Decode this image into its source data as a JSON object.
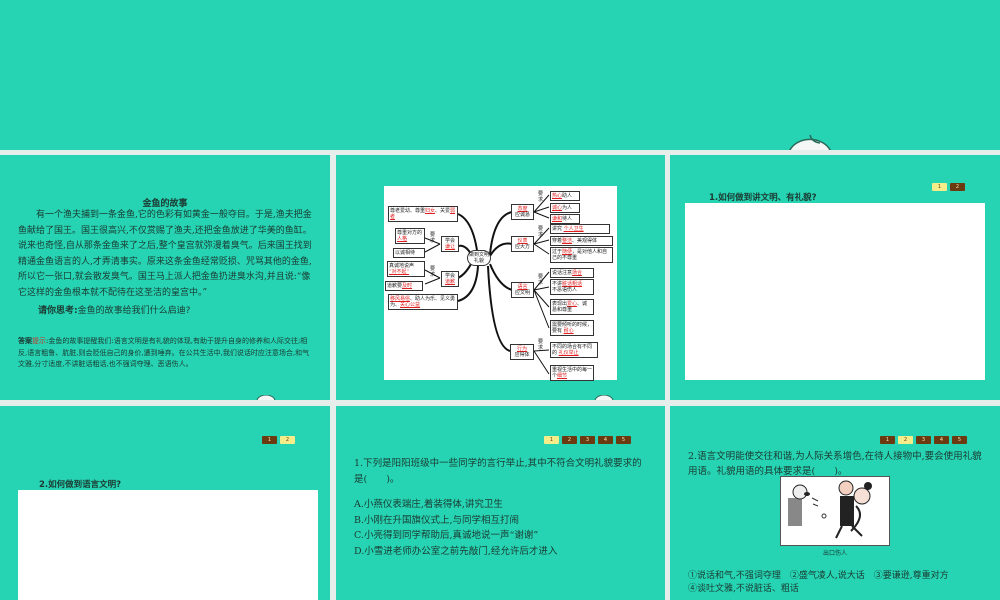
{
  "slides": {
    "story": {
      "title": "金鱼的故事",
      "body": "有一个渔夫捕到一条金鱼,它的色彩有如黄金一般夺目。于是,渔夫把金鱼献给了国王。国王很高兴,不仅赏赐了渔夫,还把金鱼放进了华美的鱼缸。说来也奇怪,自从那条金鱼来了之后,整个皇宫就弥漫着臭气。后来国王找到精通金鱼语言的人,才弄清事实。原来这条金鱼经常贬损、咒骂其他的金鱼,所以它一张口,就会散发臭气。国王马上派人把金鱼扔进臭水沟,并且说:“像它这样的金鱼根本就不配待在这圣洁的皇宫中。”",
      "think_label": "请你思考:",
      "think": "金鱼的故事给我们什么启迪?",
      "answer_label": "答案",
      "hint_label": "提示",
      "answer": ":金鱼的故事提醒我们:语言文明是有礼貌的体现,有助于提升自身的修养和人际交往;相反,语言粗鲁、肮脏,则会贬低自己的身价,遭到唾弃。在公共生活中,我们说话时应注意场合,和气文雅,分寸适度,不讲脏话粗话,也不强词夺理、恶语伤人。"
    },
    "mindmap": {
      "center": "做到文明礼貌",
      "require": "要求",
      "left": {
        "respect": [
          "尊老爱幼、尊重",
          "妇女",
          "、关爱",
          "弱者"
        ],
        "humble_node": [
          "学会",
          "谦让"
        ],
        "humble": [
          [
            "尊重对方的",
            "人格"
          ],
          [
            "以诚相待"
          ]
        ],
        "apology_node": [
          "学会",
          "道歉"
        ],
        "apology": [
          [
            "真诚地说声",
            "“对不起”"
          ],
          [
            "道歉要",
            "及时"
          ]
        ],
        "public": [
          "移风易俗",
          "、助人为乐、见义勇为、",
          "关心公益"
        ]
      },
      "right": [
        {
          "node": [
            "态度",
            "应诚恳"
          ],
          "items": [
            [
              "热心",
              "助人"
            ],
            [
              "诚心",
              "为人"
            ],
            [
              "谦和",
              "待人"
            ]
          ]
        },
        {
          "node": [
            "仪表",
            "应大方"
          ],
          "items": [
            [
              "讲究 ",
              "个人卫生",
              ""
            ],
            [
              "穿着",
              "整洁",
              "、美观得体"
            ],
            [
              "过于",
              "随便",
              "，是对他人和自己的不尊重"
            ]
          ]
        },
        {
          "node": [
            "语言",
            "应文明"
          ],
          "items": [
            [
              "说话注意",
              "场合",
              ""
            ],
            [
              "不讲",
              "脏话粗话",
              "不恶语伤人"
            ],
            [
              "表现出",
              "爱心",
              "、诚恳和尊重"
            ],
            [
              "需要倾听的时候，要有 ",
              "耐心",
              ""
            ]
          ]
        },
        {
          "node": [
            "行为",
            "应得体"
          ],
          "items": [
            [
              "不同的场合有不同的 ",
              "礼仪举止",
              ""
            ],
            [
              "重视生活中的每一个",
              "细节",
              ""
            ]
          ]
        }
      ]
    },
    "q_polite": {
      "title": "1.如何做到讲文明、有礼貌?",
      "pages": [
        "1",
        "2"
      ],
      "active": 0
    },
    "q_language": {
      "title": "2.如何做到语言文明?",
      "pages": [
        "1",
        "2"
      ],
      "active": 1
    },
    "ex1": {
      "pages": [
        "1",
        "2",
        "3",
        "4",
        "5"
      ],
      "active": 0,
      "question": "1.下列是阳阳班级中一些同学的言行举止,其中不符合文明礼貌要求的是(　　)。",
      "options": [
        "A.小燕仪表端庄,着装得体,讲究卫生",
        "B.小刚在升国旗仪式上,与同学相互打闹",
        "C.小亮得到同学帮助后,真诚地说一声“谢谢”",
        "D.小雪进老师办公室之前先敲门,经允许后才进入"
      ]
    },
    "ex2": {
      "pages": [
        "1",
        "2",
        "3",
        "4",
        "5"
      ],
      "active": 1,
      "question": "2.语言文明能使交往和谐,为人际关系增色,在待人接物中,要会使用礼貌用语。礼貌用语的具体要求是(　　)。",
      "caption": "出口伤人",
      "statements": [
        "①说话和气,不强词夺理　②盛气凌人,说大话　③要谦逊,尊重对方",
        "④谈吐文雅,不说脏话、粗话"
      ]
    }
  },
  "colors": {
    "teal": "#26d4b3",
    "page_active": "#f5ec8a",
    "page": "#6b3a10",
    "red": "#e02020"
  }
}
